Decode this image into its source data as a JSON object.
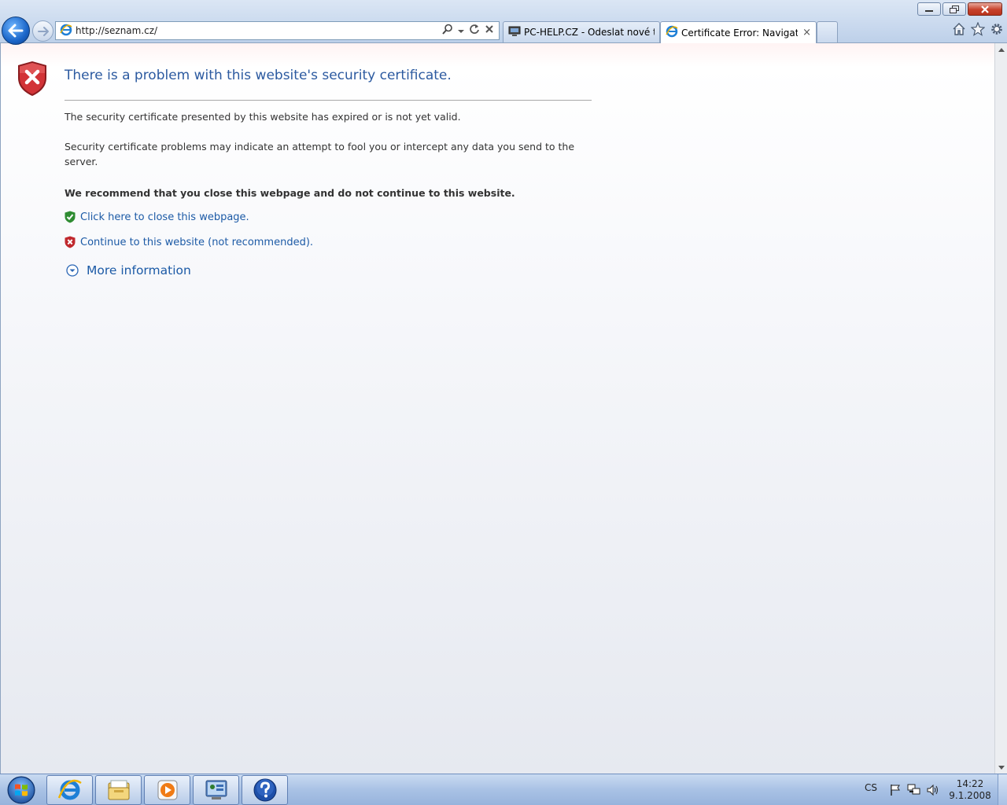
{
  "window": {
    "minimize_icon": "minimize-icon",
    "restore_icon": "restore-icon",
    "close_icon": "close-icon"
  },
  "nav": {
    "back_icon": "back-arrow-icon",
    "forward_icon": "forward-arrow-icon"
  },
  "address": {
    "url": "http://seznam.cz/",
    "search_icon": "search-icon",
    "dropdown_icon": "chevron-down-icon",
    "refresh_icon": "refresh-icon",
    "stop_icon": "stop-icon"
  },
  "tabs": [
    {
      "label": "PC-HELP.CZ - Odeslat nové té...",
      "icon": "pc-help-icon",
      "active": false
    },
    {
      "label": "Certificate Error: Navigatio...",
      "icon": "ie-icon",
      "active": true,
      "close": "×"
    }
  ],
  "toolbar_right": {
    "home_icon": "home-icon",
    "favorites_icon": "star-icon",
    "tools_icon": "gear-icon"
  },
  "page": {
    "title": "There is a problem with this website's security certificate.",
    "p1": "The security certificate presented by this website has expired or is not yet valid.",
    "p2": "Security certificate problems may indicate an attempt to fool you or intercept any data you send to the server.",
    "p3": "We recommend that you close this webpage and do not continue to this website.",
    "close_link": "Click here to close this webpage.",
    "continue_link": "Continue to this website (not recommended).",
    "more_info": "More information"
  },
  "taskbar": {
    "language": "CS",
    "time": "14:22",
    "date": "9.1.2008"
  },
  "colors": {
    "title": "#2c5aa0",
    "link": "#1c5aa6",
    "shield_red": "#c0282d",
    "shield_green": "#3a9a3a"
  }
}
